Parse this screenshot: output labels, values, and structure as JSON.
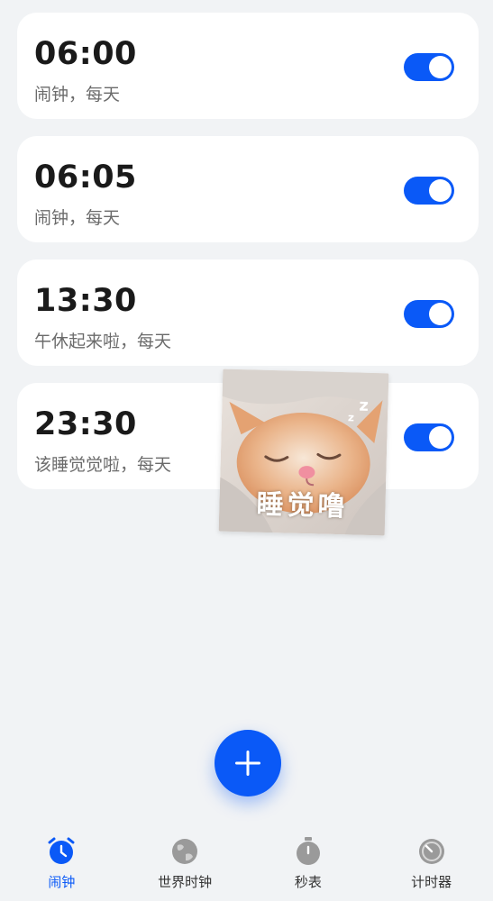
{
  "alarms": [
    {
      "time": "06:00",
      "label": "闹钟，每天",
      "enabled": true
    },
    {
      "time": "06:05",
      "label": "闹钟，每天",
      "enabled": true
    },
    {
      "time": "13:30",
      "label": "午休起来啦，每天",
      "enabled": true
    },
    {
      "time": "23:30",
      "label": "该睡觉觉啦，每天",
      "enabled": true
    }
  ],
  "sticker": {
    "caption": "睡觉噜",
    "icon": "sleeping-cat-sticker"
  },
  "fab": {
    "icon": "plus-icon"
  },
  "nav": {
    "items": [
      {
        "label": "闹钟",
        "icon": "alarm-clock-icon",
        "active": true
      },
      {
        "label": "世界时钟",
        "icon": "globe-icon",
        "active": false
      },
      {
        "label": "秒表",
        "icon": "stopwatch-icon",
        "active": false
      },
      {
        "label": "计时器",
        "icon": "timer-icon",
        "active": false
      }
    ]
  },
  "colors": {
    "accent": "#0a59f7",
    "background": "#f1f3f5",
    "card": "#ffffff"
  }
}
